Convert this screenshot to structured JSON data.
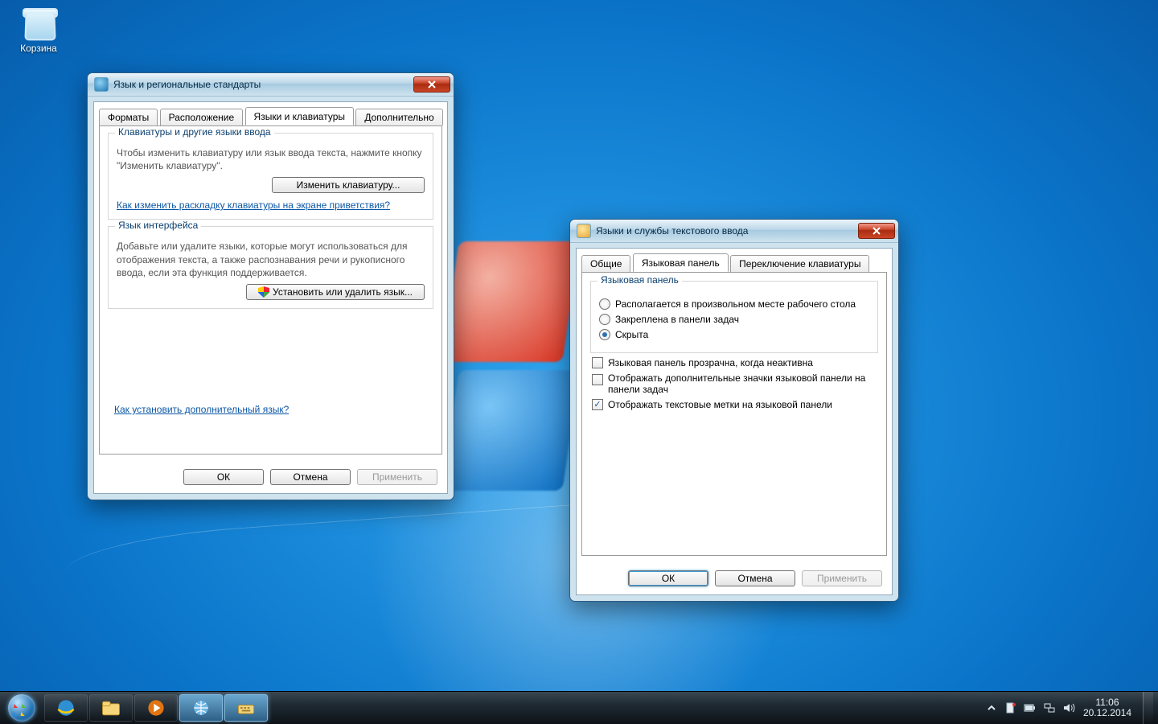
{
  "desktop": {
    "recycle_bin": "Корзина"
  },
  "win1": {
    "title": "Язык и региональные стандарты",
    "tabs": [
      "Форматы",
      "Расположение",
      "Языки и клавиатуры",
      "Дополнительно"
    ],
    "active_tab": 2,
    "group1": {
      "legend": "Клавиатуры и другие языки ввода",
      "hint": "Чтобы изменить клавиатуру или язык ввода текста, нажмите кнопку \"Изменить клавиатуру\".",
      "button": "Изменить клавиатуру...",
      "link": "Как изменить раскладку клавиатуры на экране приветствия?"
    },
    "group2": {
      "legend": "Язык интерфейса",
      "hint": "Добавьте или удалите языки, которые могут использоваться для отображения текста, а также распознавания речи и рукописного ввода, если эта функция поддерживается.",
      "button": "Установить или удалить язык..."
    },
    "footer_link": "Как установить дополнительный язык?",
    "buttons": {
      "ok": "ОК",
      "cancel": "Отмена",
      "apply": "Применить"
    }
  },
  "win2": {
    "title": "Языки и службы текстового ввода",
    "tabs": [
      "Общие",
      "Языковая панель",
      "Переключение клавиатуры"
    ],
    "active_tab": 1,
    "group": {
      "legend": "Языковая панель",
      "options": [
        "Располагается в произвольном месте рабочего стола",
        "Закреплена в панели задач",
        "Скрыта"
      ],
      "selected": 2
    },
    "checks": [
      {
        "label": "Языковая панель прозрачна, когда неактивна",
        "checked": false
      },
      {
        "label": "Отображать дополнительные значки языковой панели на панели задач",
        "checked": false
      },
      {
        "label": "Отображать текстовые метки на языковой панели",
        "checked": true
      }
    ],
    "buttons": {
      "ok": "ОК",
      "cancel": "Отмена",
      "apply": "Применить"
    }
  },
  "tray": {
    "time": "11:06",
    "date": "20.12.2014"
  }
}
